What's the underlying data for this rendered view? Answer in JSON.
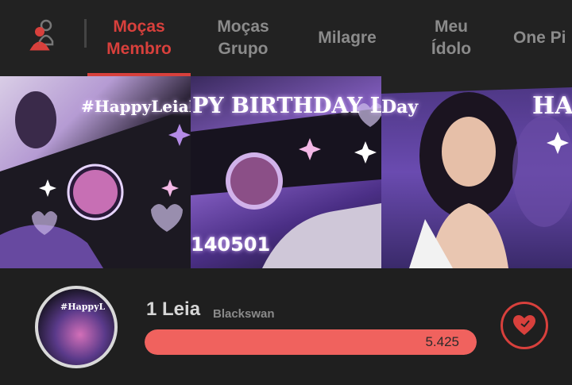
{
  "nav": {
    "tabs": [
      {
        "label": "Moças\nMembro",
        "active": true
      },
      {
        "label": "Moças\nGrupo",
        "active": false
      },
      {
        "label": "Milagre",
        "active": false
      },
      {
        "label": "Meu\nÍdolo",
        "active": false
      },
      {
        "label": "One Pi",
        "active": false
      }
    ]
  },
  "banner": {
    "hashtag": "#HappyLeiaI",
    "birthday_text": "PY BIRTHDAY LEIA",
    "date": "140501",
    "day_fragment": "Day",
    "hap_fragment": "HAP"
  },
  "entry": {
    "rank": "1",
    "name": "Leia",
    "rank_name": "1 Leia",
    "group": "Blackswan",
    "votes": "5.425",
    "progress": 1.0,
    "avatar_text": "#HappyL"
  },
  "colors": {
    "accent": "#d8403c",
    "bar": "#f0625e"
  }
}
